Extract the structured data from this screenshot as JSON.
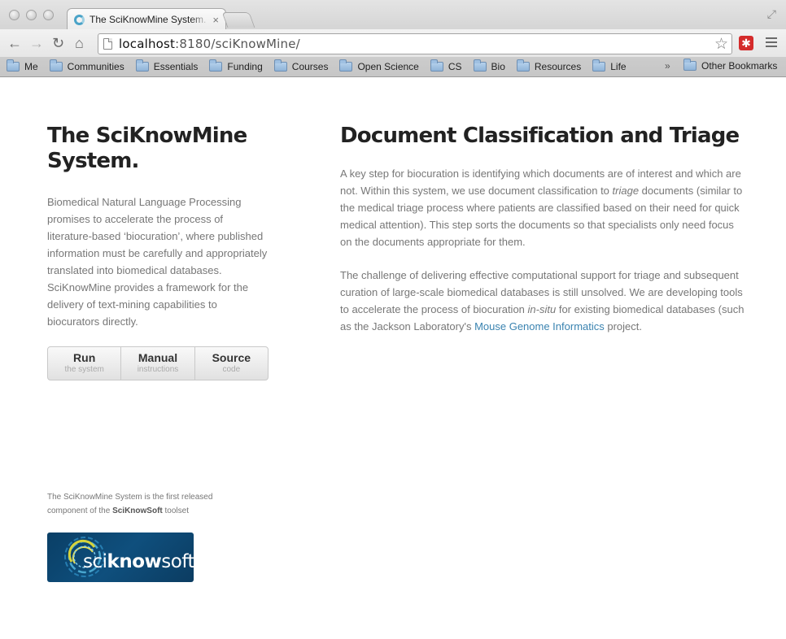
{
  "browser": {
    "tab_title": "The SciKnowMine System.",
    "tab_close": "×",
    "url_host": "localhost",
    "url_rest": ":8180/sciKnowMine/",
    "nav": {
      "back": "←",
      "forward": "→",
      "reload": "↻",
      "home": "⌂"
    },
    "ext_label": "✱",
    "bookmarks": [
      {
        "label": "Me"
      },
      {
        "label": "Communities"
      },
      {
        "label": "Essentials"
      },
      {
        "label": "Funding"
      },
      {
        "label": "Courses"
      },
      {
        "label": "Open Science"
      },
      {
        "label": "CS"
      },
      {
        "label": "Bio"
      },
      {
        "label": "Resources"
      },
      {
        "label": "Life"
      }
    ],
    "overflow": "»",
    "other_bookmarks": "Other Bookmarks"
  },
  "sidebar": {
    "title_line1": "The SciKnowMine",
    "title_line2": "System.",
    "intro": "Biomedical Natural Language Processing promises to accelerate the process of literature-based ‘biocuration’, where published information must be carefully and appropriately translated into biomedical databases. SciKnowMine provides a framework for the delivery of text-mining capabilities to biocurators directly.",
    "buttons": [
      {
        "label": "Run",
        "sub": "the system"
      },
      {
        "label": "Manual",
        "sub": "instructions"
      },
      {
        "label": "Source",
        "sub": "code"
      }
    ],
    "footer_pre": "The SciKnowMine System is the first released component of the ",
    "footer_bold": "SciKnowSoft",
    "footer_post": " toolset",
    "logo_text_pre": "sci",
    "logo_text_bold": "know",
    "logo_text_post": "soft"
  },
  "main": {
    "heading": "Document Classification and Triage",
    "p1_a": "A key step for biocuration is identifying which documents are of interest and which are not. Within this system, we use document classification to ",
    "p1_em": "triage",
    "p1_b": " documents (similar to the medical triage process where patients are classified based on their need for quick medical attention). This step sorts the documents so that specialists only need focus on the documents appropriate for them.",
    "p2_a": "The challenge of delivering effective computational support for triage and subsequent curation of large-scale biomedical databases is still unsolved. We are developing tools to accelerate the process of biocuration ",
    "p2_em": "in-situ",
    "p2_b": " for existing biomedical databases (such as the Jackson Laboratory's ",
    "p2_link": "Mouse Genome Informatics",
    "p2_c": " project."
  }
}
